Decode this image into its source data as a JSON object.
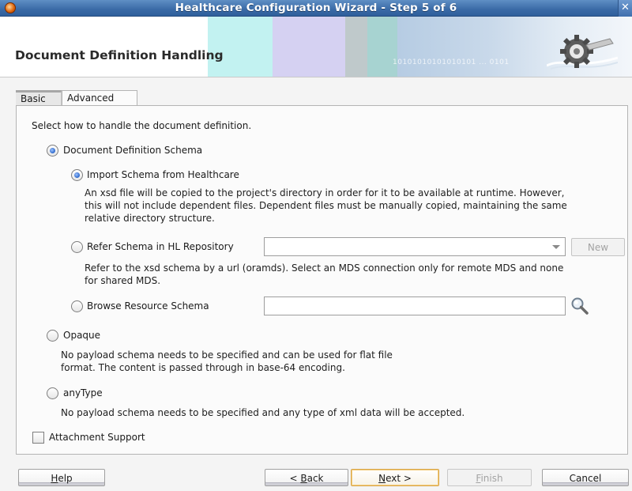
{
  "window": {
    "title": "Healthcare Configuration Wizard - Step 5 of 6",
    "close_glyph": "✕"
  },
  "header": {
    "title": "Document Definition Handling",
    "binary_text": "10101010101010101 ... 0101",
    "band_colors": [
      "#c2f2f1",
      "#d5d1f2",
      "#bfc9cb",
      "#a7d3d1"
    ]
  },
  "tabs": [
    {
      "label": "Basic",
      "selected": false
    },
    {
      "label": "Advanced",
      "selected": true
    }
  ],
  "form": {
    "instruction": "Select how to handle the document definition.",
    "opt_doc_def": {
      "label": "Document Definition Schema",
      "checked": true
    },
    "opt_import": {
      "label": "Import Schema from Healthcare",
      "checked": true,
      "desc_lines": [
        "An xsd file will be copied to the project's directory in order for it to be available at runtime.  However,",
        "this will not include dependent files.  Dependent files must be manually copied, maintaining the same",
        "relative directory structure."
      ]
    },
    "opt_refer": {
      "label": "Refer Schema in HL Repository",
      "checked": false,
      "combo_value": "",
      "new_button": "New",
      "desc_lines": [
        "Refer to the xsd schema by a url (oramds). Select an MDS connection only for remote MDS and none",
        "for shared MDS."
      ]
    },
    "opt_browse": {
      "label": "Browse Resource Schema",
      "checked": false,
      "field_value": "",
      "button_icon": "search-icon"
    },
    "opt_opaque": {
      "label": "Opaque",
      "checked": false,
      "desc_lines": [
        "No payload schema needs to be specified and can be used for flat file",
        "format. The content is passed through in base-64 encoding."
      ]
    },
    "opt_anytype": {
      "label": "anyType",
      "checked": false,
      "desc_lines": [
        "No payload schema needs to be specified and any type of xml data will be accepted."
      ]
    },
    "attachment": {
      "label": "Attachment Support",
      "checked": false
    }
  },
  "footer": {
    "help_mnemonic": "H",
    "help_rest": "elp",
    "back_prefix": "< ",
    "back_mnemonic": "B",
    "back_rest": "ack",
    "next_mnemonic": "N",
    "next_rest": "ext >",
    "finish_mnemonic": "F",
    "finish_rest": "inish",
    "cancel": "Cancel"
  }
}
